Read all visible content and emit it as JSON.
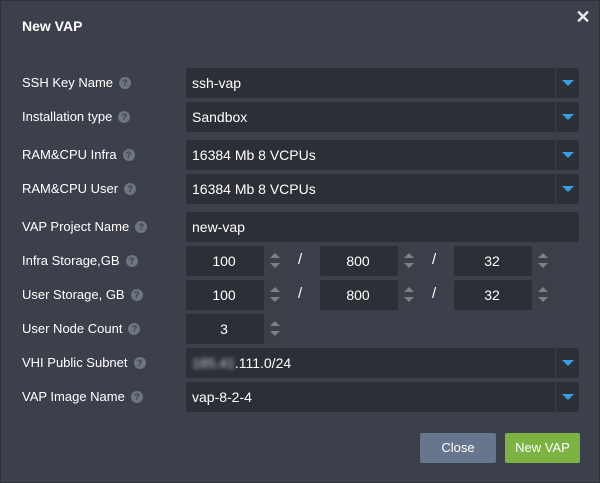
{
  "dialog": {
    "title": "New VAP",
    "close_symbol": "✕"
  },
  "fields": {
    "ssh_key": {
      "label": "SSH Key Name",
      "value": "ssh-vap"
    },
    "install_type": {
      "label": "Installation type",
      "value": "Sandbox"
    },
    "ram_cpu_infra": {
      "label": "RAM&CPU Infra",
      "value": "16384 Mb 8 VCPUs"
    },
    "ram_cpu_user": {
      "label": "RAM&CPU User",
      "value": "16384 Mb 8 VCPUs"
    },
    "project_name": {
      "label": "VAP Project Name",
      "value": "new-vap"
    },
    "infra_storage": {
      "label": "Infra Storage,GB",
      "values": [
        "100",
        "800",
        "32"
      ]
    },
    "user_storage": {
      "label": "User Storage, GB",
      "values": [
        "100",
        "800",
        "32"
      ]
    },
    "user_node_count": {
      "label": "User Node Count",
      "value": "3"
    },
    "vhi_subnet": {
      "label": "VHI Public Subnet",
      "value_hidden": "185.41",
      "value_visible": ".111.0/24"
    },
    "image_name": {
      "label": "VAP Image Name",
      "value": "vap-8-2-4"
    }
  },
  "help_glyph": "?",
  "separator": "/",
  "buttons": {
    "close": "Close",
    "create": "New VAP"
  },
  "colors": {
    "background": "#3b404a",
    "field": "#2b2f36",
    "accent_arrow": "#3a9fe0",
    "close_button": "#67768d",
    "create_button": "#7cb342"
  }
}
